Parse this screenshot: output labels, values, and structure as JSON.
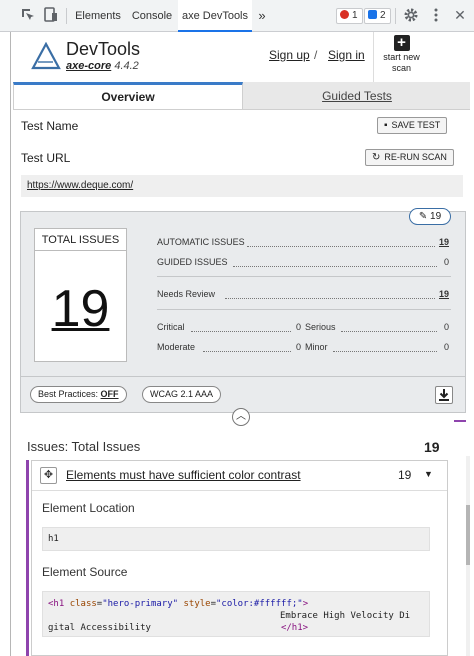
{
  "devtools": {
    "tabs": [
      "Elements",
      "Console",
      "axe DevTools"
    ],
    "more_tabs": "»",
    "errors_count": "1",
    "messages_count": "2"
  },
  "header": {
    "title": "DevTools",
    "product": "axe-core",
    "version": "4.4.2",
    "sign_up": "Sign up",
    "slash": "/",
    "sign_in": "Sign in",
    "new_scan_line1": "start new",
    "new_scan_line2": "scan"
  },
  "tabs": {
    "overview": "Overview",
    "guided": "Guided Tests"
  },
  "form": {
    "test_name_label": "Test Name",
    "save_label": "SAVE TEST",
    "test_url_label": "Test URL",
    "rerun_label": "RE-RUN SCAN",
    "url": "https://www.deque.com/"
  },
  "summary": {
    "badge_count": "19",
    "total_label": "TOTAL ISSUES",
    "total": "19",
    "automatic_label": "AUTOMATIC ISSUES",
    "automatic": "19",
    "guided_label": "GUIDED ISSUES",
    "guided": "0",
    "review_label": "Needs Review",
    "review": "19",
    "critical_label": "Critical",
    "critical": "0",
    "serious_label": "Serious",
    "serious": "0",
    "moderate_label": "Moderate",
    "moderate": "0",
    "minor_label": "Minor",
    "minor": "0",
    "best_practices_label": "Best Practices:",
    "best_practices_value": "OFF",
    "standard": "WCAG 2.1 AAA"
  },
  "issues": {
    "header": "Issues: Total Issues",
    "count": "19",
    "rule": "Elements must have sufficient color contrast",
    "rule_count": "19",
    "location_label": "Element Location",
    "location": "h1",
    "source_label": "Element Source",
    "source_tag_open": "<h1",
    "source_attr1": "class",
    "source_val1": "\"hero-primary\"",
    "source_attr2": "style",
    "source_val2": "\"color:#ffffff;\"",
    "source_tag_close": ">",
    "source_text1": "Embrace High Velocity Di",
    "source_text2": "gital Accessibility",
    "source_end": "</h1>"
  },
  "colors": {
    "accent": "#3a7bc8",
    "purple": "#8e44ad",
    "error": "#d93025",
    "info": "#1a73e8"
  }
}
